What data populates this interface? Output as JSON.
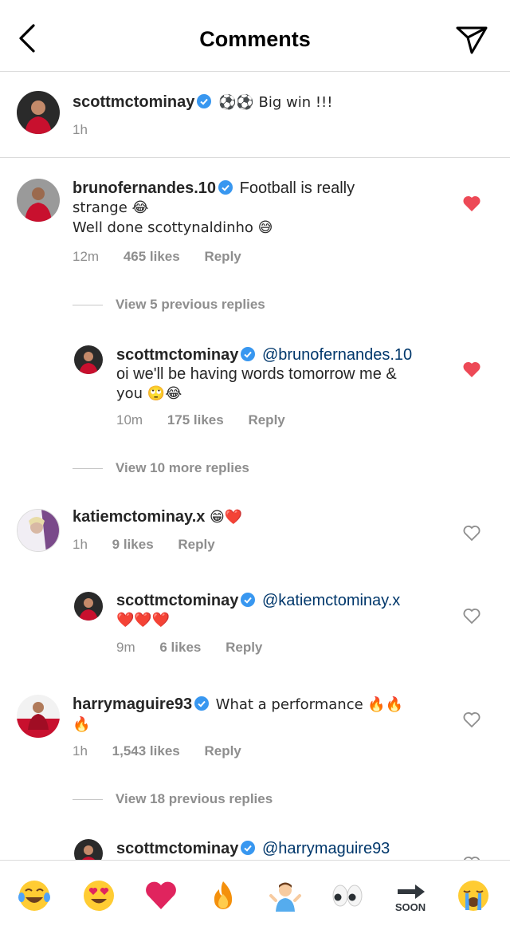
{
  "header": {
    "title": "Comments"
  },
  "caption": {
    "username": "scottmctominay",
    "text": "⚽⚽ Big win !!!",
    "time": "1h"
  },
  "comments": [
    {
      "username": "brunofernandes.10",
      "line1": "Football is really",
      "line2": "strange 😂",
      "line3": "Well done scottynaldinho 😅",
      "time": "12m",
      "likes": "465 likes",
      "reply": "Reply"
    }
  ],
  "view_replies_1": "View 5 previous replies",
  "reply_1": {
    "username": "scottmctominay",
    "mention": "@brunofernandes.10",
    "line2": "oi we'll be having words tomorrow me &",
    "line3": "you 🙄😂",
    "time": "10m",
    "likes": "175 likes",
    "reply": "Reply"
  },
  "view_replies_2": "View 10 more replies",
  "comment_2": {
    "username": "katiemctominay.x",
    "text": "😁❤️",
    "time": "1h",
    "likes": "9 likes",
    "reply": "Reply"
  },
  "reply_2": {
    "username": "scottmctominay",
    "mention": "@katiemctominay.x",
    "line2": "❤️❤️❤️",
    "time": "9m",
    "likes": "6 likes",
    "reply": "Reply"
  },
  "comment_3": {
    "username": "harrymaguire93",
    "text": "What a performance 🔥🔥",
    "line2": "🔥",
    "time": "1h",
    "likes": "1,543 likes",
    "reply": "Reply"
  },
  "view_replies_3": "View 18 previous replies",
  "reply_3": {
    "username": "scottmctominay",
    "mention": "@harrymaguire93"
  },
  "emoji_bar": [
    "😂",
    "😍",
    "❤️",
    "🔥",
    "🤷‍♂️",
    "👀",
    "🔜",
    "😭"
  ],
  "colors": {
    "liked_heart": "#ed4956",
    "verified": "#3897f0",
    "mention": "#00376b",
    "meta": "#8e8e8e"
  }
}
